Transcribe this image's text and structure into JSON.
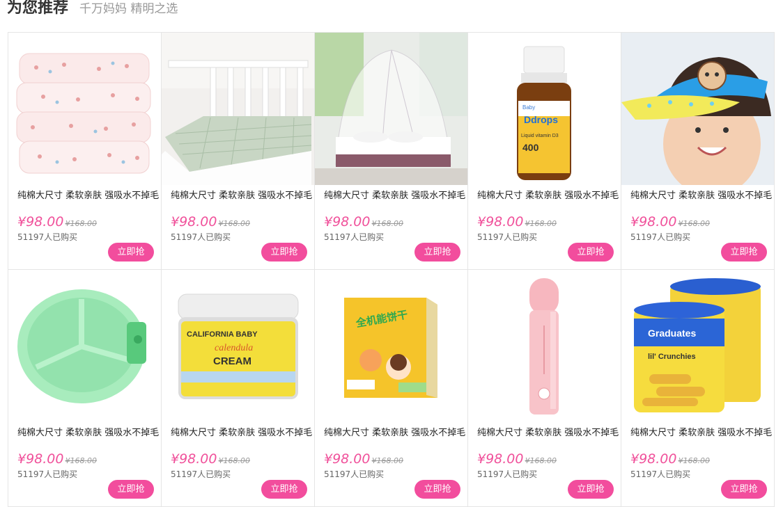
{
  "section": {
    "title": "为您推荐",
    "subtitle": "千万妈妈 精明之选"
  },
  "products": [
    {
      "name": "纯棉大尺寸 柔软亲肤 强吸水不掉毛",
      "price": "¥98.00",
      "old_price": "¥168.00",
      "sold": "51197人已购买",
      "button": "立即抢",
      "image": "folded-blankets"
    },
    {
      "name": "纯棉大尺寸 柔软亲肤 强吸水不掉毛",
      "price": "¥98.00",
      "old_price": "¥168.00",
      "sold": "51197人已购买",
      "button": "立即抢",
      "image": "crib-mattress"
    },
    {
      "name": "纯棉大尺寸 柔软亲肤 强吸水不掉毛",
      "price": "¥98.00",
      "old_price": "¥168.00",
      "sold": "51197人已购买",
      "button": "立即抢",
      "image": "mosquito-net"
    },
    {
      "name": "纯棉大尺寸 柔软亲肤 强吸水不掉毛",
      "price": "¥98.00",
      "old_price": "¥168.00",
      "sold": "51197人已购买",
      "button": "立即抢",
      "image": "vitamin-drops-bottle"
    },
    {
      "name": "纯棉大尺寸 柔软亲肤 强吸水不掉毛",
      "price": "¥98.00",
      "old_price": "¥168.00",
      "sold": "51197人已购买",
      "button": "立即抢",
      "image": "child-sun-visor"
    },
    {
      "name": "纯棉大尺寸 柔软亲肤 强吸水不掉毛",
      "price": "¥98.00",
      "old_price": "¥168.00",
      "sold": "51197人已购买",
      "button": "立即抢",
      "image": "divided-plate"
    },
    {
      "name": "纯棉大尺寸 柔软亲肤 强吸水不掉毛",
      "price": "¥98.00",
      "old_price": "¥168.00",
      "sold": "51197人已购买",
      "button": "立即抢",
      "image": "cream-jar"
    },
    {
      "name": "纯棉大尺寸 柔软亲肤 强吸水不掉毛",
      "price": "¥98.00",
      "old_price": "¥168.00",
      "sold": "51197人已购买",
      "button": "立即抢",
      "image": "biscuit-box"
    },
    {
      "name": "纯棉大尺寸 柔软亲肤 强吸水不掉毛",
      "price": "¥98.00",
      "old_price": "¥168.00",
      "sold": "51197人已购买",
      "button": "立即抢",
      "image": "pink-tube"
    },
    {
      "name": "纯棉大尺寸 柔软亲肤 强吸水不掉毛",
      "price": "¥98.00",
      "old_price": "¥168.00",
      "sold": "51197人已购买",
      "button": "立即抢",
      "image": "snack-canisters"
    }
  ],
  "product_art": {
    "vitamin": {
      "brand": "Ddrops",
      "line1": "Baby",
      "line2": "Liquid vitamin D3",
      "line3": "400"
    },
    "cream": {
      "brand": "CALIFORNIA BABY",
      "line1": "calendula",
      "line2": "CREAM"
    },
    "biscuit": {
      "line1": "全机能饼干"
    },
    "snack": {
      "brand": "Graduates",
      "line1": "lil' Crunchies"
    }
  }
}
